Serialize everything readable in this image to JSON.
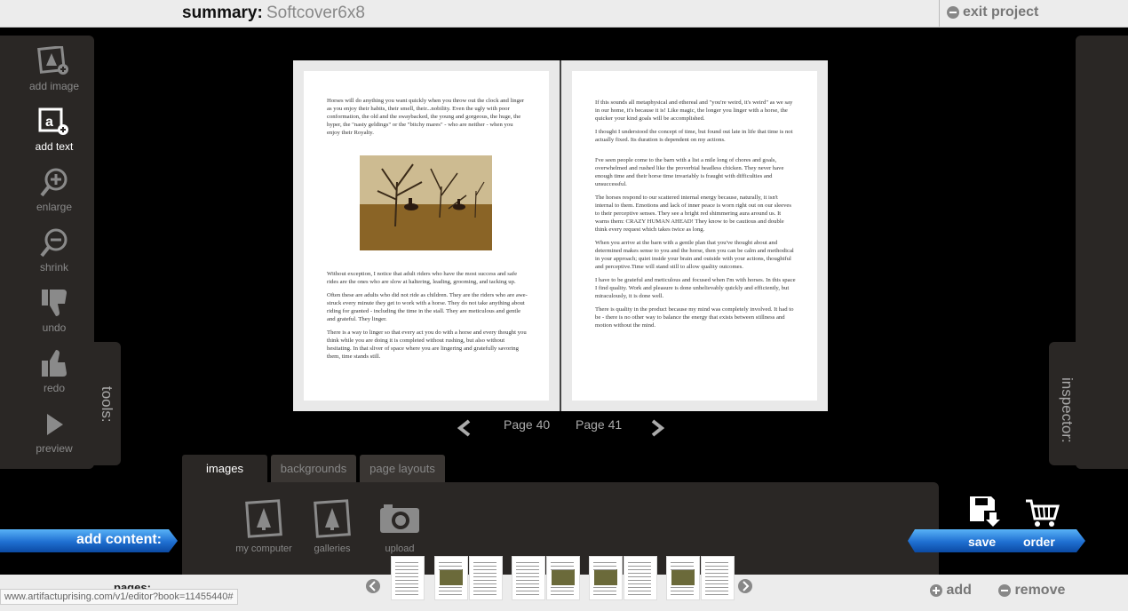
{
  "header": {
    "summary_label": "summary:",
    "summary_value": "Softcover6x8",
    "exit_label": "exit project"
  },
  "tools": {
    "items": [
      {
        "label": "add image",
        "icon": "add-image-icon"
      },
      {
        "label": "add text",
        "icon": "add-text-icon",
        "active": true
      },
      {
        "label": "enlarge",
        "icon": "zoom-in-icon"
      },
      {
        "label": "shrink",
        "icon": "zoom-out-icon"
      },
      {
        "label": "undo",
        "icon": "thumbs-down-icon"
      },
      {
        "label": "redo",
        "icon": "thumbs-up-icon"
      },
      {
        "label": "preview",
        "icon": "play-icon"
      }
    ],
    "tab_label": "tools:"
  },
  "inspector": {
    "tab_label": "inspector:"
  },
  "book": {
    "left_page": {
      "para1": "Horses will do anything you want quickly when you throw out the clock and linger as you enjoy their habits, their smell, their...nobility. Even the ugly with poor conformation, the old and the swaybacked, the young and gorgeous, the huge, the hyper, the \"nasty geldings\" or the \"bitchy mares\" - who are neither - when you enjoy their Royalty.",
      "para2": "Without exception, I notice that adult riders who have the most success and safe rides are the ones who are slow at haltering, leading, grooming, and tacking up.",
      "para3": "Often these are adults who did not ride as children. They are the riders who are awe-struck every minute they get to work with a horse. They do not take anything about riding for granted - including the time in the stall. They are meticulous and gentle and grateful. They linger.",
      "para4": "There is a way to linger so that every act you do with a horse and every thought you think while you are doing it is completed without rushing, but also without hesitating. In that sliver of space where you are lingering and gratefully savoring them, time stands still."
    },
    "right_page": {
      "para1": "If this sounds all metaphysical and ethereal and \"you're weird, it's weird\" as we say in our home, it's because it is! Like magic, the longer you linger with a horse, the quicker your kind goals will be accomplished.",
      "para2": "I thought I understood the concept of time, but found out late in life that time is not actually fixed. Its duration is dependent on my actions.",
      "para3": "I've seen people come to the barn with a list a mile long of chores and goals, overwhelmed and rushed like the proverbial headless chicken. They never have enough time and their horse time invariably is fraught with difficulties and unsuccessful.",
      "para4": "The horses respond to our scattered internal energy because, naturally, it isn't internal to them. Emotions and lack of inner peace is worn right out on our sleeves to their perceptive senses. They see a bright red shimmering aura around us. It warns them: CRAZY HUMAN AHEAD! They know to be cautious and double think every request which takes twice as long.",
      "para5": "When you arrive at the barn with a gentle plan that you've thought about and determined makes sense to you and the horse, then you can be calm and methodical in your approach; quiet inside your brain and outside with your actions, thoughtful and perceptive.Time will stand still to allow quality outcomes.",
      "para6": "I have to be grateful and meticulous and focused when I'm with horses. In this space I find quality. Work and pleasure is done unbelievably quickly and efficiently, but miraculously, it is done well.",
      "para7": "There is quality in the product because my mind was completely involved. It had to be - there is no other way to balance the energy that exists between stillness and motion without the mind."
    },
    "page_left_label": "Page 40",
    "page_right_label": "Page 41"
  },
  "content_panel": {
    "tabs": [
      "images",
      "backgrounds",
      "page layouts"
    ],
    "active_tab": "images",
    "sources": [
      {
        "label": "my computer",
        "icon": "photo-frame-icon"
      },
      {
        "label": "galleries",
        "icon": "photo-frame-icon"
      },
      {
        "label": "upload",
        "icon": "camera-icon"
      }
    ],
    "add_content_label": "add content:",
    "save_label": "save",
    "order_label": "order"
  },
  "pages_strip": {
    "label": "pages:",
    "add_label": "add",
    "remove_label": "remove"
  },
  "status_bar": {
    "url": "www.artifactuprising.com/v1/editor?book=11455440#"
  }
}
